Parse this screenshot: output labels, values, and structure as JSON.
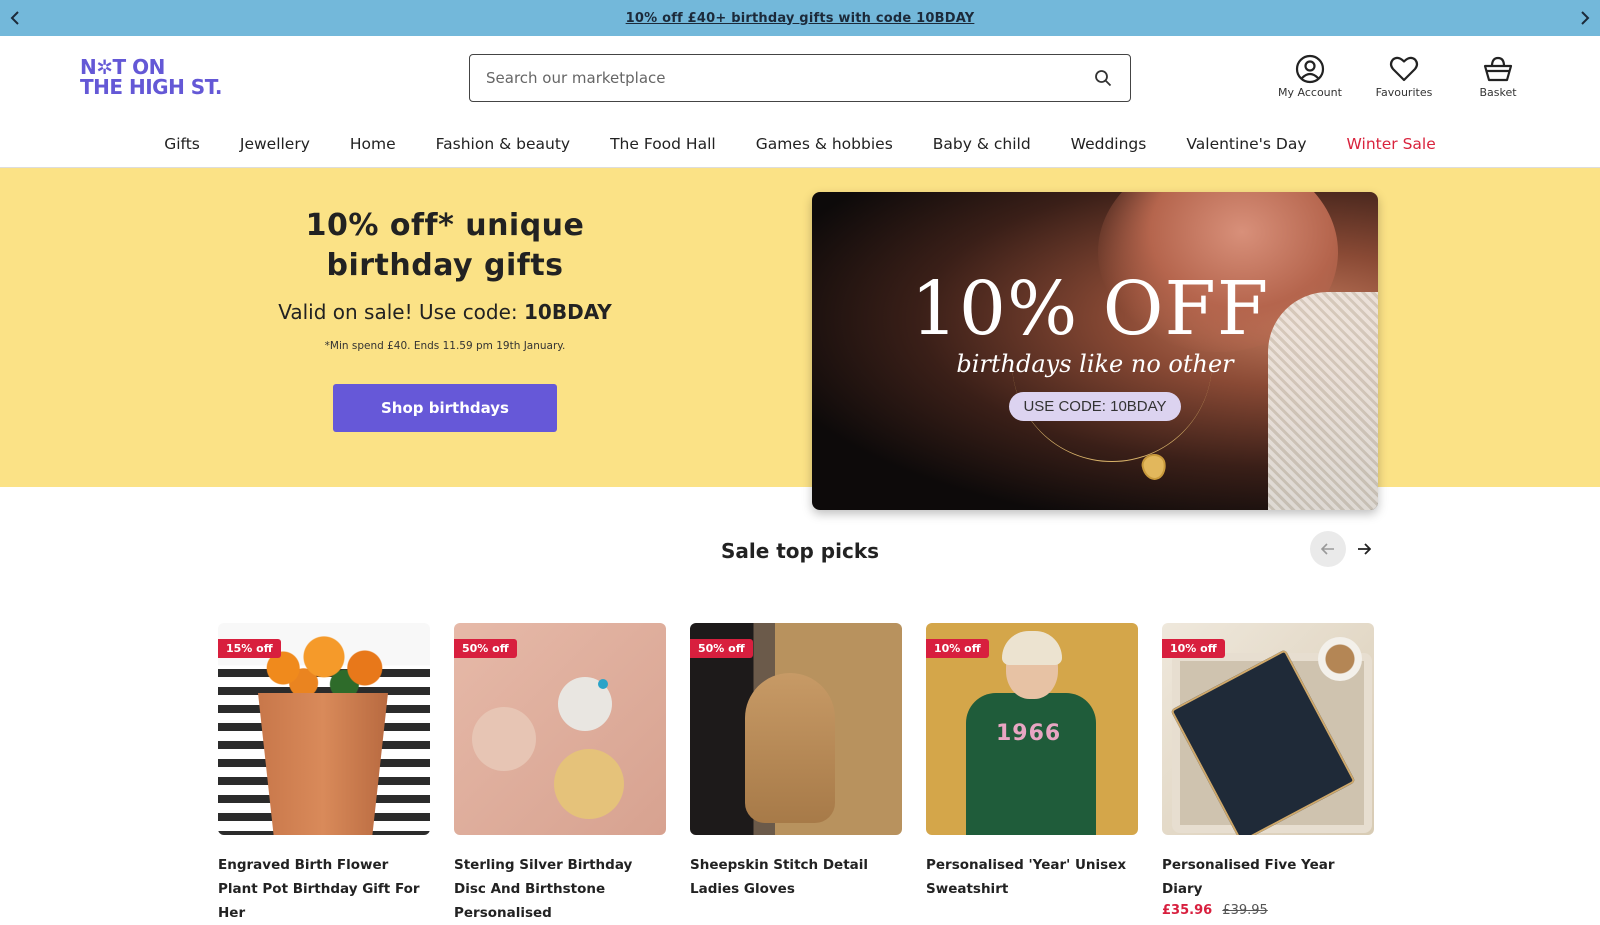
{
  "promo": {
    "text": "10% off £40+ birthday gifts with code 10BDAY"
  },
  "header": {
    "logo_line1": "N✲T ON",
    "logo_line2": "THE HIGH ST.",
    "search_placeholder": "Search our marketplace",
    "actions": [
      {
        "label": "My Account",
        "icon": "account-icon"
      },
      {
        "label": "Favourites",
        "icon": "heart-icon"
      },
      {
        "label": "Basket",
        "icon": "basket-icon"
      }
    ]
  },
  "nav": {
    "items": [
      "Gifts",
      "Jewellery",
      "Home",
      "Fashion & beauty",
      "The Food Hall",
      "Games & hobbies",
      "Baby & child",
      "Weddings",
      "Valentine's Day",
      "Winter Sale"
    ],
    "sale_color": "#d9233d"
  },
  "hero": {
    "title_line1": "10% off* unique",
    "title_line2": "birthday gifts",
    "sub_prefix": "Valid on sale! Use code: ",
    "code": "10BDAY",
    "fine_print": "*Min spend £40. Ends 11.59 pm 19th January.",
    "button": "Shop birthdays",
    "image_big": "10% OFF",
    "image_script": "birthdays like no other",
    "image_code": "USE CODE: 10BDAY",
    "background": "#fbe286",
    "accent": "#6658d8"
  },
  "picks": {
    "title": "Sale top picks",
    "products": [
      {
        "badge": "15% off",
        "name": "Engraved Birth Flower Plant Pot Birthday Gift For Her",
        "price_now": "",
        "price_was": ""
      },
      {
        "badge": "50% off",
        "name": "Sterling Silver Birthday Disc And Birthstone Personalised",
        "price_now": "",
        "price_was": ""
      },
      {
        "badge": "50% off",
        "name": "Sheepskin Stitch Detail Ladies Gloves",
        "price_now": "",
        "price_was": ""
      },
      {
        "badge": "10% off",
        "name": "Personalised 'Year' Unisex Sweatshirt",
        "price_now": "",
        "price_was": ""
      },
      {
        "badge": "10% off",
        "name": "Personalised Five Year Diary",
        "price_now": "£35.96",
        "price_was": "£39.95"
      }
    ],
    "sweatshirt_year": "1966"
  }
}
